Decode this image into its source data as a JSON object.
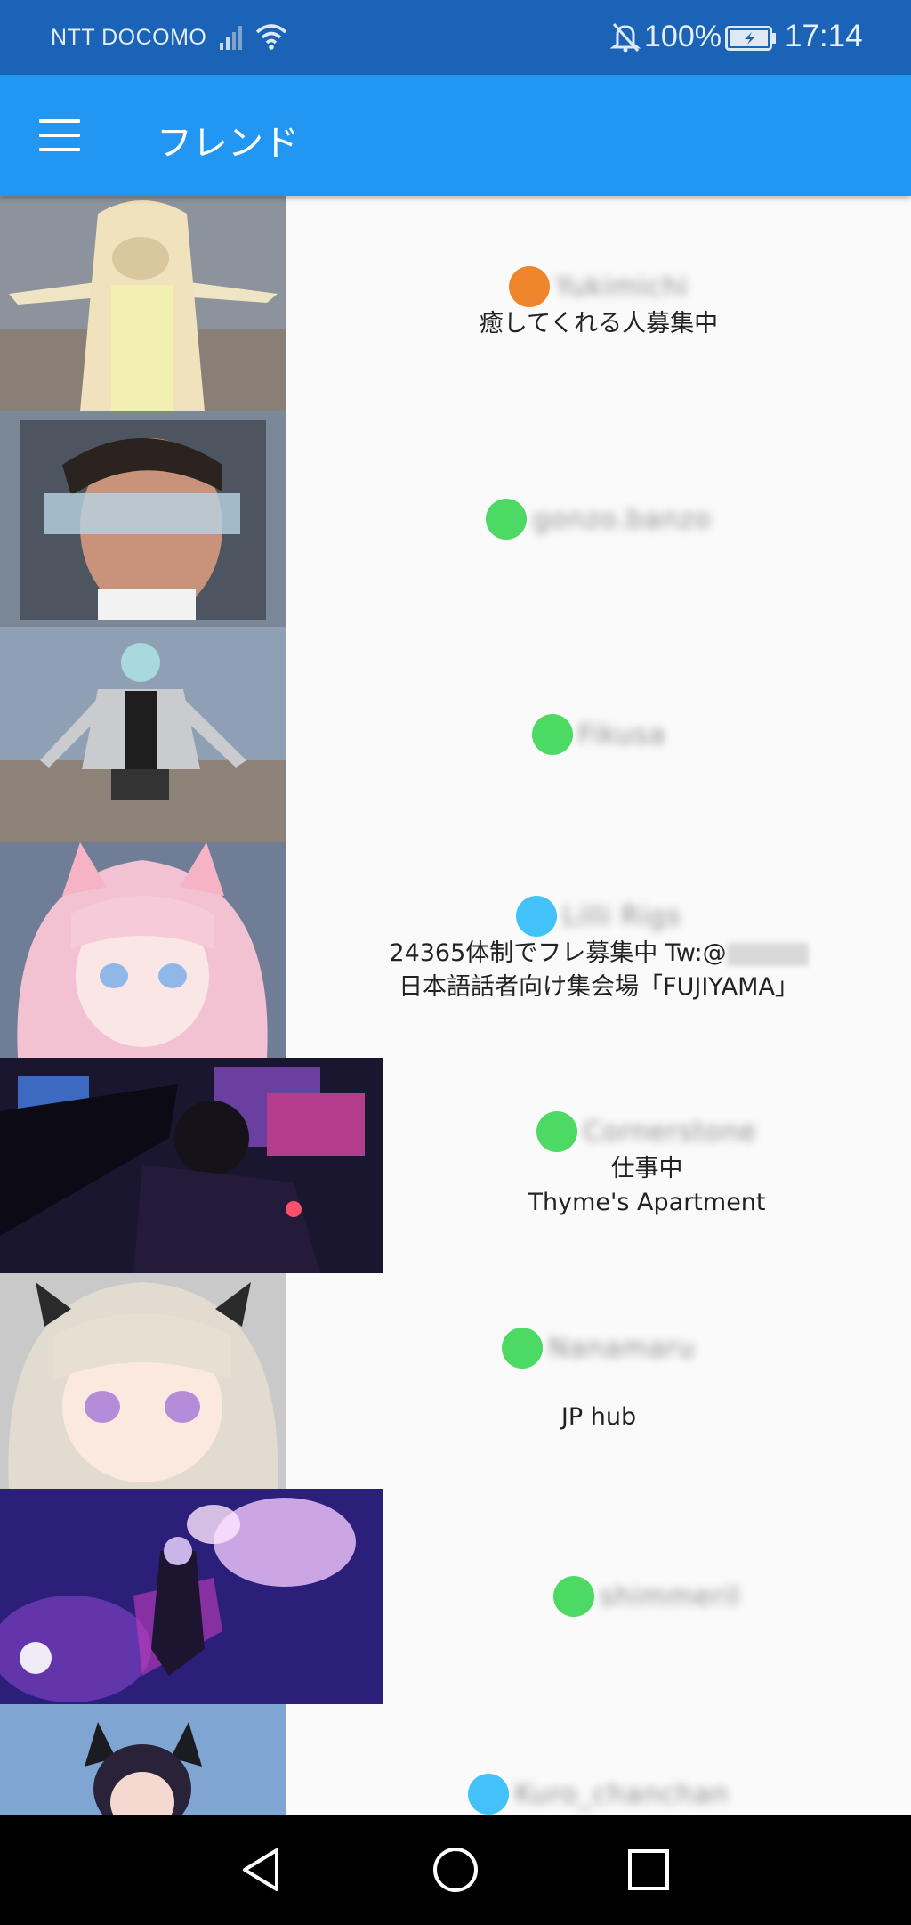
{
  "status_bar": {
    "carrier": "NTT DOCOMO",
    "battery": "100%",
    "time": "17:14",
    "icons": [
      "signal-icon",
      "wifi-icon",
      "mute-icon",
      "battery-icon"
    ]
  },
  "app_bar": {
    "title": "フレンド",
    "menu_icon": "hamburger-menu-icon",
    "color": "#2196f3"
  },
  "friends": [
    {
      "name": "Yukimichi",
      "status_color": "#f0862c",
      "status_message": "癒してくれる人募集中",
      "world": ""
    },
    {
      "name": "gonzo.banzo",
      "status_color": "#4cd964",
      "status_message": "",
      "world": ""
    },
    {
      "name": "Fikusa",
      "status_color": "#4cd964",
      "status_message": "",
      "world": ""
    },
    {
      "name": "Lilli Rigs",
      "status_color": "#42c2f8",
      "status_message": "24365体制でフレ募集中 Tw:@",
      "world": "日本語話者向け集会場「FUJIYAMA」"
    },
    {
      "name": "Cornerstone",
      "status_color": "#4cd964",
      "status_message": "仕事中",
      "world": "Thyme's Apartment"
    },
    {
      "name": "Nanamaru",
      "status_color": "#4cd964",
      "status_message": "",
      "world": "JP hub"
    },
    {
      "name": "shimmeril",
      "status_color": "#4cd964",
      "status_message": "",
      "world": ""
    },
    {
      "name": "Kuro_chanchan",
      "status_color": "#42c2f8",
      "status_message": "",
      "world": ""
    }
  ],
  "nav_bar": {
    "back_icon": "back-triangle-icon",
    "home_icon": "home-circle-icon",
    "recents_icon": "recents-square-icon"
  }
}
